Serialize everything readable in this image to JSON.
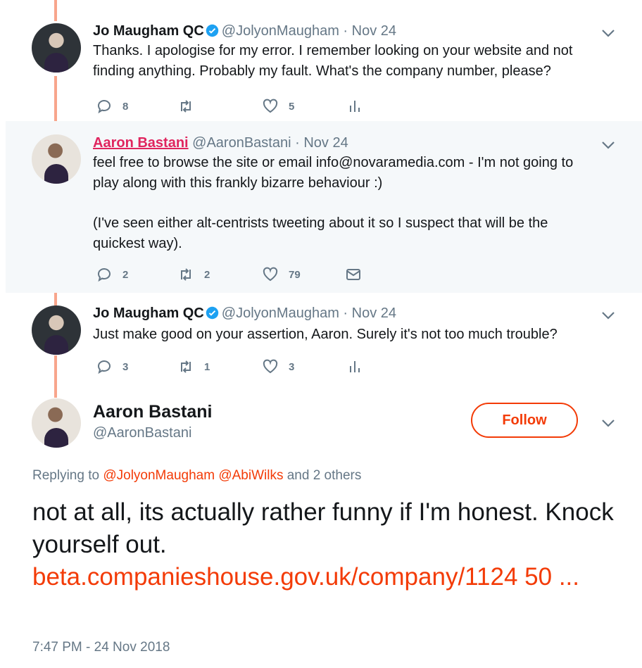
{
  "tweets": [
    {
      "name": "Jo Maugham QC",
      "handle": "@JolyonMaugham",
      "date": "· Nov 24",
      "text": "Thanks. I apologise for my error. I remember looking on your website and not finding anything. Probably my fault. What's the company number, please?",
      "replies": "8",
      "retweets": "",
      "likes": "5"
    },
    {
      "name": "Aaron Bastani",
      "handle": "@AaronBastani",
      "date": "· Nov 24",
      "text1": "feel free to browse the site or email info@novaramedia.com - I'm not going to play along with this frankly bizarre behaviour :)",
      "text2": "(I've seen either alt-centrists tweeting about it so I suspect that will be the quickest way).",
      "replies": "2",
      "retweets": "2",
      "likes": "79"
    },
    {
      "name": "Jo Maugham QC",
      "handle": "@JolyonMaugham",
      "date": "· Nov 24",
      "text": "Just make good on your assertion, Aaron. Surely it's not too much trouble?",
      "replies": "3",
      "retweets": "1",
      "likes": "3"
    }
  ],
  "main": {
    "name": "Aaron Bastani",
    "handle": "@AaronBastani",
    "follow_label": "Follow",
    "replying_prefix": "Replying to",
    "replying_handles": [
      "@JolyonMaugham",
      "@AbiWilks"
    ],
    "replying_suffix": "and 2 others",
    "text": "not at all, its actually rather funny if I'm honest. Knock yourself out.",
    "link": "beta.companieshouse.gov.uk/company/1124 50 ...",
    "timestamp": "7:47 PM - 24 Nov 2018"
  },
  "colors": {
    "accent": "#f33b07",
    "thread_line": "#f8a58c",
    "muted": "#657786",
    "highlight_bg": "#f5f8fa"
  },
  "icons": [
    "verified-icon",
    "chevron-down-icon",
    "reply-icon",
    "retweet-icon",
    "like-icon",
    "analytics-icon",
    "direct-message-icon"
  ]
}
